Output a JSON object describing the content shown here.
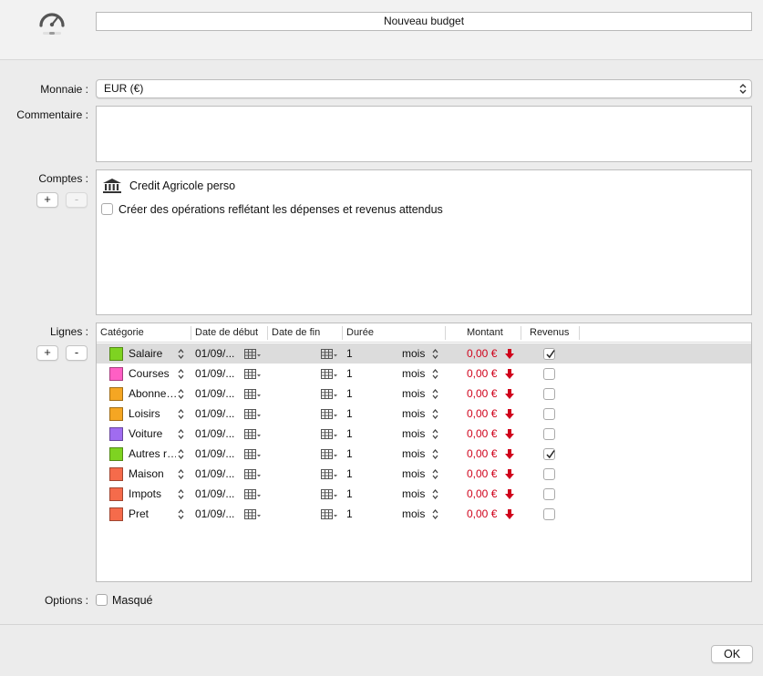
{
  "header": {
    "name_value": "Nouveau budget",
    "icon": "gauge-icon"
  },
  "form": {
    "currency_label": "Monnaie :",
    "currency_value": "EUR (€)",
    "comment_label": "Commentaire :",
    "comment_value": "",
    "accounts_label": "Comptes :",
    "add_label": "+",
    "remove_label": "-",
    "account_name": "Credit Agricole perso",
    "create_ops_label": "Créer des opérations reflétant les dépenses et revenus attendus",
    "lines_label": "Lignes :",
    "options_label": "Options :",
    "hidden_label": "Masqué",
    "ok_label": "OK"
  },
  "table": {
    "columns": [
      "Catégorie",
      "Date de début",
      "Date de fin",
      "Durée",
      "Montant",
      "Revenus"
    ],
    "rows": [
      {
        "category": "Salaire",
        "color": "#7ed321",
        "start": "01/09/...",
        "duration": "1",
        "unit": "mois",
        "amount": "0,00 €",
        "revenue": true,
        "selected": true
      },
      {
        "category": "Courses",
        "color": "#ff5fc4",
        "start": "01/09/...",
        "duration": "1",
        "unit": "mois",
        "amount": "0,00 €",
        "revenue": false,
        "selected": false
      },
      {
        "category": "Abonne…",
        "color": "#f5a623",
        "start": "01/09/...",
        "duration": "1",
        "unit": "mois",
        "amount": "0,00 €",
        "revenue": false,
        "selected": false
      },
      {
        "category": "Loisirs",
        "color": "#f5a623",
        "start": "01/09/...",
        "duration": "1",
        "unit": "mois",
        "amount": "0,00 €",
        "revenue": false,
        "selected": false
      },
      {
        "category": "Voiture",
        "color": "#a06cf0",
        "start": "01/09/...",
        "duration": "1",
        "unit": "mois",
        "amount": "0,00 €",
        "revenue": false,
        "selected": false
      },
      {
        "category": "Autres r…",
        "color": "#7ed321",
        "start": "01/09/...",
        "duration": "1",
        "unit": "mois",
        "amount": "0,00 €",
        "revenue": true,
        "selected": false
      },
      {
        "category": "Maison",
        "color": "#f56b4b",
        "start": "01/09/...",
        "duration": "1",
        "unit": "mois",
        "amount": "0,00 €",
        "revenue": false,
        "selected": false
      },
      {
        "category": "Impots",
        "color": "#f56b4b",
        "start": "01/09/...",
        "duration": "1",
        "unit": "mois",
        "amount": "0,00 €",
        "revenue": false,
        "selected": false
      },
      {
        "category": "Pret",
        "color": "#f56b4b",
        "start": "01/09/...",
        "duration": "1",
        "unit": "mois",
        "amount": "0,00 €",
        "revenue": false,
        "selected": false
      }
    ]
  },
  "colors": {
    "amount": "#d0021b",
    "selected_row": "#dcdcdc"
  }
}
